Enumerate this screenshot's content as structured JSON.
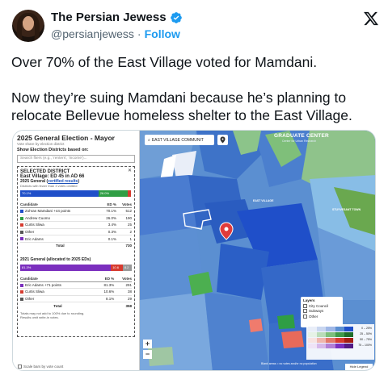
{
  "tweet": {
    "display_name": "The Persian Jewess",
    "handle": "@persianjewess",
    "separator": "·",
    "follow_label": "Follow",
    "text_line1": "Over 70% of the East Village voted for Mamdani.",
    "text_line2": "Now they’re suing Mamdani because he’s planning to relocate Bellevue homeless shelter to the East Village."
  },
  "icons": {
    "verified": "verified-badge-icon",
    "x_logo": "x-logo-icon",
    "avatar": "avatar"
  },
  "colors": {
    "verified": "#1d9bf0",
    "link": "#1d9bf0",
    "mamdani": "#1f4fc9",
    "cuomo": "#2f9e44",
    "sliwa": "#d63b2f",
    "adams": "#7b2fbe",
    "map_base": "#5b8fd1"
  },
  "panel": {
    "title": "2025 General Election - Mayor",
    "subtitle": "Vote share by election district",
    "show_label": "Show Election Districts based on:",
    "search_placeholder": "Search fliers (e.g., 'renters', 'income')...",
    "selected_header": "SELECTED DISTRICT",
    "district_name": "East Village: ED 45 in AD 66",
    "section1_prefix": "2025 General (",
    "section1_link": "certified results",
    "section1_suffix": ")",
    "section1_note": "Districts with fewer than 3 votes omitted",
    "bar1": [
      {
        "label": "70.1%",
        "pct": 70.1,
        "color": "#1f4fc9"
      },
      {
        "label": "26.0%",
        "pct": 26.0,
        "color": "#2f9e44"
      },
      {
        "label": "",
        "pct": 3.4,
        "color": "#d63b2f"
      }
    ],
    "table_headers": [
      "Candidate",
      "ED %",
      "Votes"
    ],
    "rows1": [
      {
        "name": "Zohran Mamdani  +44 points",
        "pct": "70.1%",
        "votes": "512",
        "color": "#1f4fc9"
      },
      {
        "name": "Andrew Cuomo",
        "pct": "26.0%",
        "votes": "190",
        "color": "#2f9e44"
      },
      {
        "name": "Curtis Sliwa",
        "pct": "3.4%",
        "votes": "25",
        "color": "#d63b2f"
      },
      {
        "name": "Other",
        "pct": "0.3%",
        "votes": "2",
        "color": "#555555"
      },
      {
        "name": "Eric Adams",
        "pct": "0.1%",
        "votes": "1",
        "color": "#7b2fbe"
      }
    ],
    "total1_label": "Total",
    "total1": "730",
    "section2_title": "2021 General (allocated to 2025 EDs)",
    "bar2": [
      {
        "label": "81.3%",
        "pct": 81.3,
        "color": "#7b2fbe"
      },
      {
        "label": "10.6",
        "pct": 10.6,
        "color": "#d63b2f"
      },
      {
        "label": "8.2",
        "pct": 8.1,
        "color": "#999999"
      }
    ],
    "rows2": [
      {
        "name": "Eric Adams  +71 points",
        "pct": "81.3%",
        "votes": "291",
        "color": "#7b2fbe"
      },
      {
        "name": "Curtis Sliwa",
        "pct": "10.6%",
        "votes": "38",
        "color": "#d63b2f"
      },
      {
        "name": "Other",
        "pct": "8.1%",
        "votes": "29",
        "color": "#555555"
      }
    ],
    "total2_label": "Total",
    "total2": "358",
    "foot1": "Totals may not add to 100% due to rounding.",
    "foot2": "Results omit write-in votes.",
    "scale_label": "Scale bars by vote count"
  },
  "map": {
    "search_value": "EAST VILLAGE COMMUNIT",
    "brand": "GRADUATE CENTER",
    "brand_sub": "Center for Urban Research",
    "zoom_in": "+",
    "zoom_out": "−",
    "layers_title": "Layers",
    "layers": [
      "City Council",
      "Subways",
      "Other"
    ],
    "legend_labels": [
      "0 – 25%",
      "25 – 50%",
      "50 – 75%",
      "75 – 100%"
    ],
    "legend_colors": [
      [
        "#e9eef8",
        "#c9d6f0",
        "#9fb7e6",
        "#5b8fd1",
        "#1f4fc9"
      ],
      [
        "#e6f2e6",
        "#b9dcb9",
        "#7cbf7c",
        "#3f9a4a",
        "#1f6e2c"
      ],
      [
        "#f7e3e1",
        "#efb6ae",
        "#e2786b",
        "#d63b2f",
        "#a51d14"
      ],
      [
        "#efe3f6",
        "#d6b8ea",
        "#b27fd6",
        "#7b2fbe",
        "#521a85"
      ]
    ],
    "note": "Blank areas = no votes and/or no population",
    "hide_legend": "Hide Legend",
    "area_labels": [
      "EAST VILLAGE",
      "STUYVESANT TOWN"
    ]
  }
}
